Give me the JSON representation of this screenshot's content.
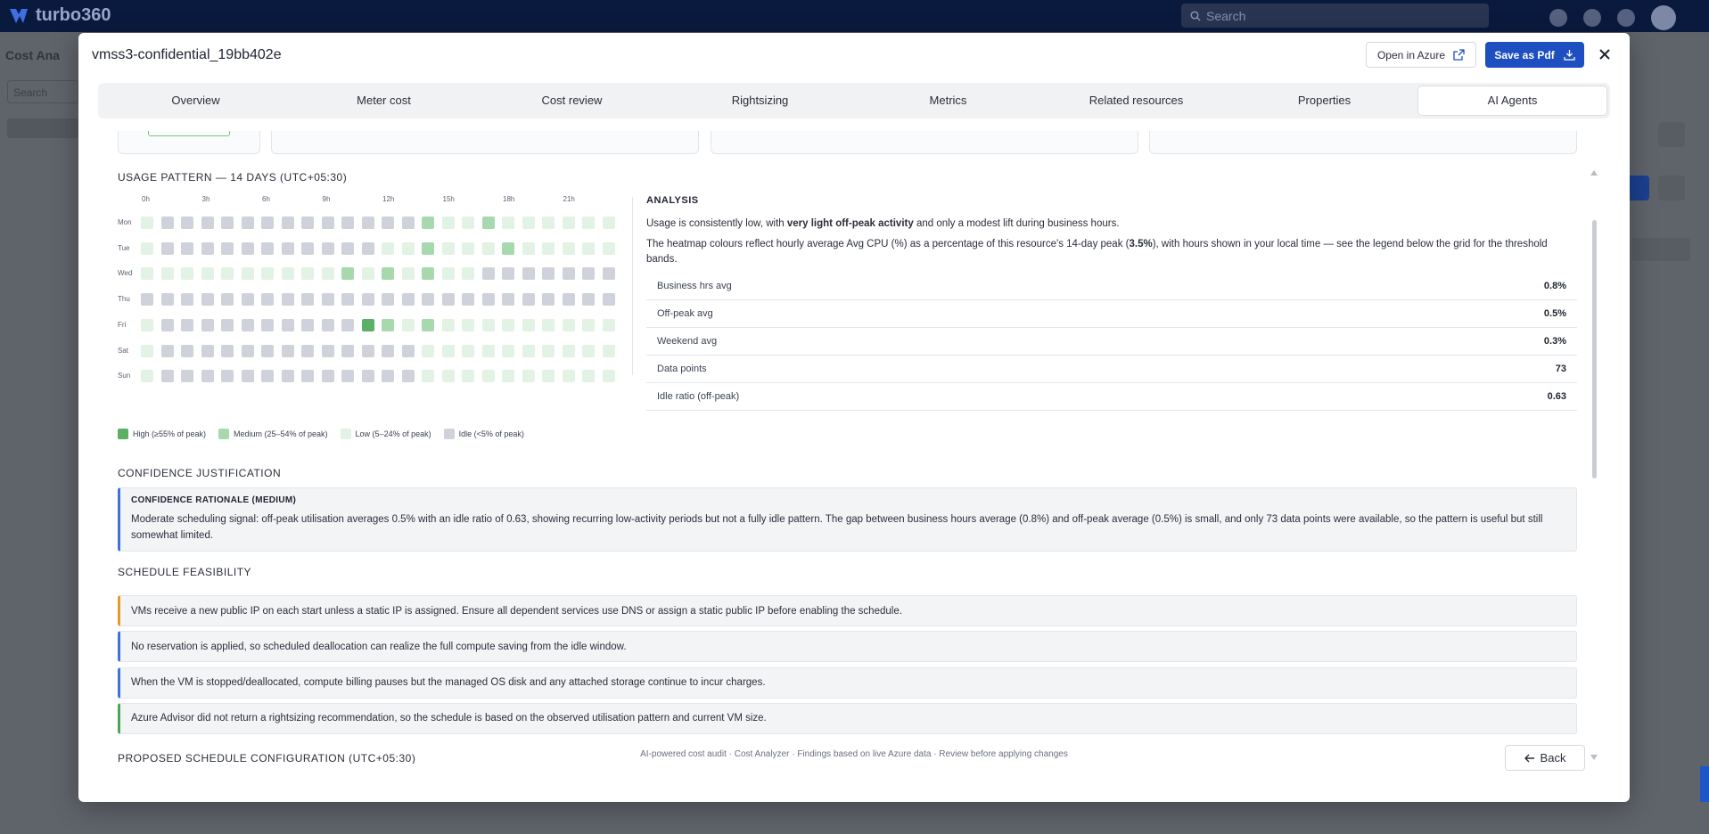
{
  "app": {
    "brand": "turbo360",
    "search_placeholder": "Search",
    "bg_title": "Cost Ana",
    "bg_search": "Search"
  },
  "modal": {
    "title": "vmss3-confidential_19bb402e",
    "open_azure": "Open in Azure",
    "save_pdf": "Save as Pdf"
  },
  "tabs": [
    "Overview",
    "Meter cost",
    "Cost review",
    "Rightsizing",
    "Metrics",
    "Related resources",
    "Properties",
    "AI Agents"
  ],
  "active_tab": "AI Agents",
  "usage": {
    "heading": "USAGE PATTERN — 14 DAYS (UTC+05:30)",
    "hour_labels": [
      "0h",
      "3h",
      "6h",
      "9h",
      "12h",
      "15h",
      "18h",
      "21h"
    ],
    "days": [
      "Mon",
      "Tue",
      "Wed",
      "Thu",
      "Fri",
      "Sat",
      "Sun"
    ],
    "levels_key": "0=idle,1=low,2=medium,3=high",
    "grid": [
      [
        1,
        0,
        0,
        0,
        0,
        0,
        0,
        0,
        0,
        0,
        0,
        0,
        0,
        0,
        2,
        1,
        1,
        2,
        1,
        1,
        1,
        1,
        1,
        1
      ],
      [
        1,
        0,
        0,
        0,
        0,
        0,
        0,
        0,
        0,
        0,
        0,
        0,
        1,
        1,
        2,
        1,
        1,
        1,
        2,
        1,
        1,
        1,
        1,
        1
      ],
      [
        1,
        1,
        1,
        1,
        1,
        1,
        1,
        1,
        1,
        1,
        2,
        1,
        2,
        1,
        2,
        1,
        1,
        0,
        0,
        0,
        0,
        0,
        0,
        0
      ],
      [
        0,
        0,
        0,
        0,
        0,
        0,
        0,
        0,
        0,
        0,
        0,
        0,
        0,
        0,
        0,
        0,
        0,
        0,
        0,
        0,
        0,
        0,
        0,
        0
      ],
      [
        1,
        0,
        0,
        0,
        0,
        0,
        0,
        0,
        0,
        0,
        0,
        3,
        2,
        1,
        2,
        1,
        1,
        1,
        1,
        1,
        1,
        1,
        1,
        1
      ],
      [
        1,
        0,
        0,
        0,
        0,
        0,
        0,
        0,
        0,
        0,
        0,
        0,
        0,
        0,
        1,
        1,
        1,
        1,
        1,
        1,
        1,
        1,
        1,
        1
      ],
      [
        1,
        0,
        0,
        0,
        0,
        0,
        0,
        0,
        0,
        0,
        0,
        0,
        0,
        0,
        1,
        1,
        1,
        1,
        1,
        1,
        1,
        1,
        1,
        1
      ]
    ],
    "colors": {
      "high": "#5bb066",
      "medium": "#a8d9ae",
      "low": "#e2f2e4",
      "idle": "#cfd2db"
    },
    "legend": [
      {
        "key": "high",
        "label": "High (≥55% of peak)"
      },
      {
        "key": "medium",
        "label": "Medium (25–54% of peak)"
      },
      {
        "key": "low",
        "label": "Low (5–24% of peak)"
      },
      {
        "key": "idle",
        "label": "Idle (<5% of peak)"
      }
    ]
  },
  "analysis": {
    "title": "ANALYSIS",
    "p1_pre": "Usage is consistently low, with ",
    "p1_bold": "very light off-peak activity",
    "p1_post": " and only a modest lift during business hours.",
    "p2_pre": "The heatmap colours reflect hourly average Avg CPU (%) as a percentage of this resource's 14-day peak (",
    "p2_bold": "3.5%",
    "p2_post": "), with hours shown in your local time — see the legend below the grid for the threshold bands.",
    "stats": [
      {
        "label": "Business hrs avg",
        "value": "0.8%"
      },
      {
        "label": "Off-peak avg",
        "value": "0.5%"
      },
      {
        "label": "Weekend avg",
        "value": "0.3%"
      },
      {
        "label": "Data points",
        "value": "73"
      },
      {
        "label": "Idle ratio (off-peak)",
        "value": "0.63"
      }
    ]
  },
  "confidence": {
    "heading": "CONFIDENCE JUSTIFICATION",
    "box_title": "CONFIDENCE RATIONALE (MEDIUM)",
    "text": "Moderate scheduling signal: off-peak utilisation averages 0.5% with an idle ratio of 0.63, showing recurring low-activity periods but not a fully idle pattern. The gap between business hours average (0.8%) and off-peak average (0.5%) is small, and only 73 data points were available, so the pattern is useful but still somewhat limited."
  },
  "feasibility": {
    "heading": "SCHEDULE FEASIBILITY",
    "items": [
      {
        "type": "warn",
        "text": "VMs receive a new public IP on each start unless a static IP is assigned. Ensure all dependent services use DNS or assign a static public IP before enabling the schedule."
      },
      {
        "type": "info",
        "text": "No reservation is applied, so scheduled deallocation can realize the full compute saving from the idle window."
      },
      {
        "type": "info",
        "text": "When the VM is stopped/deallocated, compute billing pauses but the managed OS disk and any attached storage continue to incur charges."
      },
      {
        "type": "ok",
        "text": "Azure Advisor did not return a rightsizing recommendation, so the schedule is based on the observed utilisation pattern and current VM size."
      }
    ]
  },
  "proposed_heading": "PROPOSED SCHEDULE CONFIGURATION (UTC+05:30)",
  "footer": "AI-powered cost audit · Cost Analyzer · Findings based on live Azure data · Review before applying changes",
  "back": "Back"
}
